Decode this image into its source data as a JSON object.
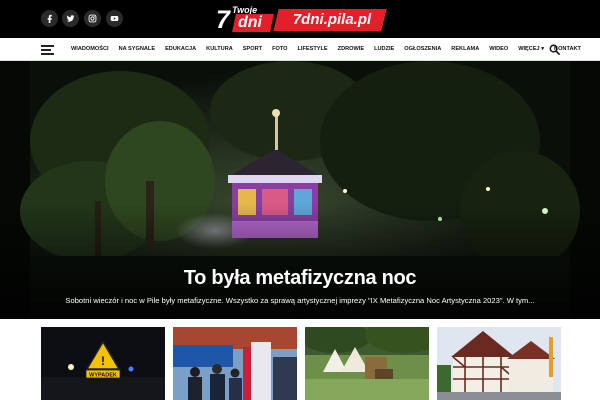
{
  "social": [
    {
      "name": "facebook-icon",
      "glyph": "f"
    },
    {
      "name": "twitter-icon",
      "glyph": "t"
    },
    {
      "name": "instagram-icon",
      "glyph": "◎"
    },
    {
      "name": "youtube-icon",
      "glyph": "▶"
    }
  ],
  "logo": {
    "twoje": "Twoje",
    "seven": "7",
    "dni": "dni",
    "site": "7dni.pila.pl"
  },
  "nav": {
    "items": [
      "WIADOMOŚCI",
      "NA SYGNALE",
      "EDUKACJA",
      "KULTURA",
      "SPORT",
      "FOTO",
      "LIFESTYLE",
      "ZDROWIE",
      "LUDZIE",
      "OGŁOSZENIA",
      "REKLAMA",
      "WIDEO",
      "WIĘCEJ ▾",
      "KONTAKT"
    ]
  },
  "hero": {
    "title": "To była metafizyczna noc",
    "excerpt": "Sobotni wieczór i noc w Pile były metafizyczne. Wszystko za sprawą artystycznej imprezy \"IX Metafizyczna Noc Artystyczna 2023\". W tym..."
  },
  "thumbs": [
    {
      "sign": "WYPADEK"
    }
  ],
  "colors": {
    "brand_red": "#e3202a",
    "topbar": "#000000"
  }
}
